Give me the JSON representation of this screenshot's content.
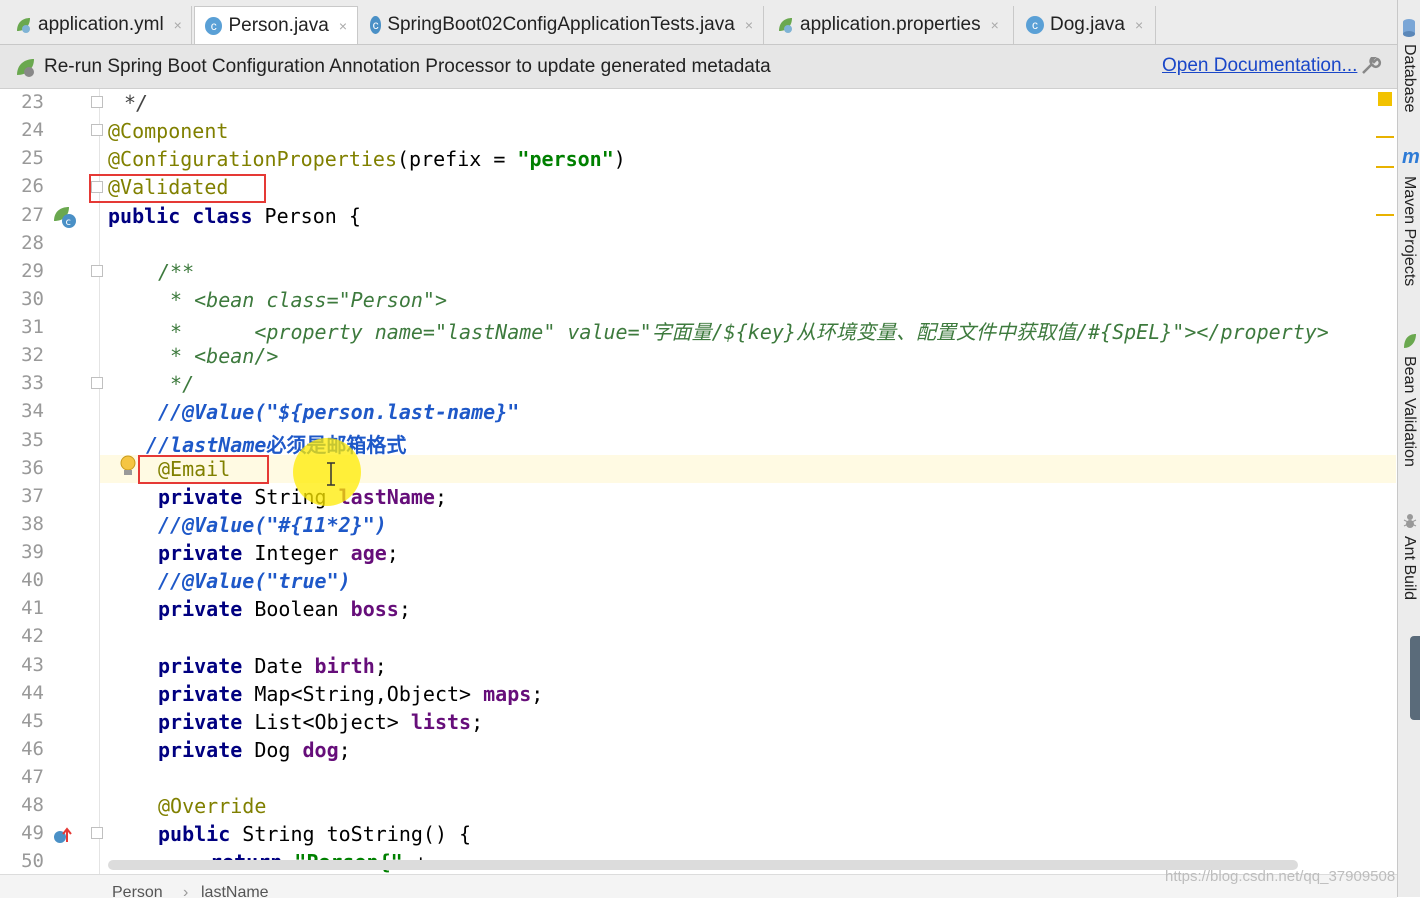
{
  "tabs": [
    {
      "label": "application.yml",
      "icon": "spring-leaf-icon"
    },
    {
      "label": "Person.java",
      "icon": "class-c-icon"
    },
    {
      "label": "SpringBoot02ConfigApplicationTests.java",
      "icon": "class-c-icon"
    },
    {
      "label": "application.properties",
      "icon": "spring-leaf-icon"
    },
    {
      "label": "Dog.java",
      "icon": "class-c-icon"
    }
  ],
  "close_glyph": "×",
  "banner": {
    "text": "Re-run Spring Boot Configuration Annotation Processor to update generated metadata",
    "link": "Open Documentation..."
  },
  "line_numbers": [
    "23",
    "24",
    "25",
    "26",
    "27",
    "28",
    "29",
    "30",
    "31",
    "32",
    "33",
    "34",
    "35",
    "36",
    "37",
    "38",
    "39",
    "40",
    "41",
    "42",
    "43",
    "44",
    "45",
    "46",
    "47",
    "48",
    "49",
    "50"
  ],
  "code": {
    "l23": "*/",
    "l24": "@Component",
    "l25_ann": "@ConfigurationProperties",
    "l25_mid": "(prefix = ",
    "l25_str": "\"person\"",
    "l25_end": ")",
    "l26": "@Validated",
    "l27_kw": "public class",
    "l27_rest": " Person {",
    "l29": "/**",
    "l30": " * <bean class=\"Person\">",
    "l31": " *      <property name=\"lastName\" value=\"字面量/${key}从环境变量、配置文件中获取值/#{SpEL}\"></property>",
    "l32": " * <bean/>",
    "l33": " */",
    "l34": "//@Value(\"${person.last-name}\"",
    "l35_a": "//lastName",
    "l35_b": "必须是邮箱格式",
    "l36": "@Email",
    "l37_kw": "private",
    "l37_type": " String ",
    "l37_fld": "lastName",
    "l38": "//@Value(\"#{11*2}\")",
    "l39_kw": "private",
    "l39_type": " Integer ",
    "l39_fld": "age",
    "l40": "//@Value(\"true\")",
    "l41_kw": "private",
    "l41_type": " Boolean ",
    "l41_fld": "boss",
    "l43_kw": "private",
    "l43_type": " Date ",
    "l43_fld": "birth",
    "l44_kw": "private",
    "l44_type": " Map<String,Object> ",
    "l44_fld": "maps",
    "l45_kw": "private",
    "l45_type": " List<Object> ",
    "l45_fld": "lists",
    "l46_kw": "private",
    "l46_type": " Dog ",
    "l46_fld": "dog",
    "l48": "@Override",
    "l49_kw": "public",
    "l49_rest": " String toString() {",
    "l50_kw": "return",
    "l50_str": "\"Person{\"",
    "l50_end": " +",
    "semicolon": ";"
  },
  "right_tools": [
    "Database",
    "Maven Projects",
    "Bean Validation",
    "Ant Build"
  ],
  "right_tool_glyph": "m",
  "breadcrumb": [
    "Person",
    "lastName"
  ],
  "breadcrumb_sep": "›",
  "watermark": "https://blog.csdn.net/qq_37909508",
  "colors": {
    "annotation": "#808000",
    "keyword": "#000080",
    "string": "#008000",
    "field": "#660e7a",
    "highlight_box": "#e53935",
    "caret_row": "#fffae3",
    "link": "#1a47c8"
  }
}
